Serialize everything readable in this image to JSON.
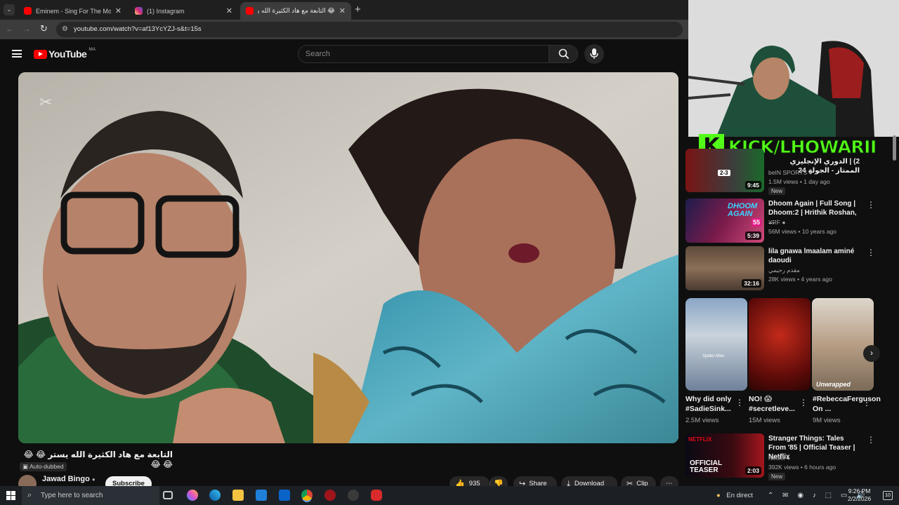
{
  "tabs": [
    {
      "title": "Eminem - Sing For The Moment",
      "color": "#ff0000"
    },
    {
      "title": "(1) Instagram",
      "color": "#d6249f"
    },
    {
      "title": "😂 التابعة مع هاد الكثيرة الله يستر",
      "color": "#ff0000"
    }
  ],
  "address": {
    "url": "youtube.com/watch?v=af13YcYZJ-s&t=15s"
  },
  "header": {
    "logo": "YouTube",
    "region": "MA",
    "search_placeholder": "Search"
  },
  "overlay": {
    "streamer_tag": "KICK/LHOWARII",
    "kick_k": "K"
  },
  "video": {
    "title": "التابعة مع هاد الكثيرة الله يستر 😂 😂 😂 😂",
    "badge": "Auto-dubbed",
    "channel": "Jawad Bingo",
    "subscribe": "Subscribe",
    "likes": "935",
    "share": "Share",
    "download": "Download",
    "clip": "Clip"
  },
  "related": [
    {
      "title": "2) | الدوري الإنجليزي الممتاز - الجولة 24",
      "channel": "beIN SPORTS",
      "meta": "1.5M views • 1 day ago",
      "badge": "New",
      "duration": "9:45",
      "score": "2-3"
    },
    {
      "title": "Dhoom Again | Full Song | Dhoom:2 | Hrithik Roshan, ...",
      "channel": "YRF",
      "meta": "56M views • 10 years ago",
      "badge": "",
      "duration": "5:39",
      "thumb_text": "DHOOM AGAIN",
      "thumb_num": "55"
    },
    {
      "title": "lila gnawa lmaalam aminé daoudi",
      "channel": "مقدم رحيمي",
      "meta": "28K views • 4 years ago",
      "badge": "",
      "duration": "32:16"
    },
    {
      "title": "Stranger Things: Tales From '85 | Official Teaser | Netflix",
      "channel": "Netflix",
      "meta": "392K views • 6 hours ago",
      "badge": "New",
      "duration": "2:03",
      "thumb_brand": "NETFLIX",
      "thumb_text": "OFFICIAL TEASER"
    }
  ],
  "shorts": [
    {
      "title": "Why did only #SadieSink...",
      "views": "2.5M views",
      "caption": "Spider-Man"
    },
    {
      "title": "NO! 😱 #secretleve...",
      "views": "15M views",
      "caption": ""
    },
    {
      "title": "#RebeccaFerguson On ...",
      "views": "9M views",
      "caption": "Unwrapped"
    }
  ],
  "taskbar": {
    "search": "Type here to search",
    "status": "En direct",
    "time": "9:26 PM",
    "date": "2/2/2026",
    "notif": "10"
  }
}
